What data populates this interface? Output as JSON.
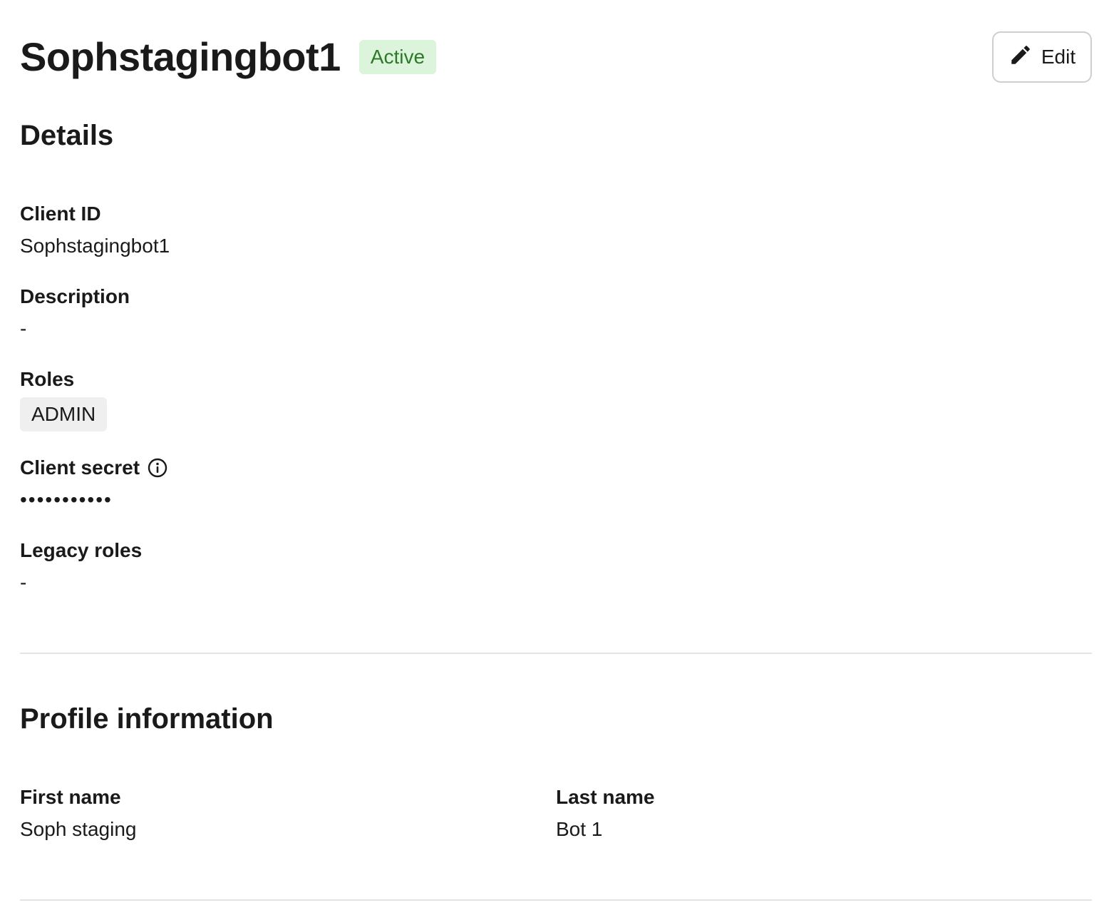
{
  "header": {
    "title": "Sophstagingbot1",
    "status": "Active",
    "edit_label": "Edit"
  },
  "details": {
    "section_title": "Details",
    "client_id": {
      "label": "Client ID",
      "value": "Sophstagingbot1"
    },
    "description": {
      "label": "Description",
      "value": "-"
    },
    "roles": {
      "label": "Roles",
      "items": [
        "ADMIN"
      ]
    },
    "client_secret": {
      "label": "Client secret",
      "value": "•••••••••••"
    },
    "legacy_roles": {
      "label": "Legacy roles",
      "value": "-"
    }
  },
  "profile": {
    "section_title": "Profile information",
    "first_name": {
      "label": "First name",
      "value": "Soph staging"
    },
    "last_name": {
      "label": "Last name",
      "value": "Bot 1"
    }
  },
  "colors": {
    "status_bg": "#ddf4dc",
    "status_text": "#2c7a28",
    "chip_bg": "#efefef",
    "divider": "#e4e4e4"
  },
  "icons": {
    "edit": "pencil-icon",
    "secret_info": "info-icon"
  }
}
